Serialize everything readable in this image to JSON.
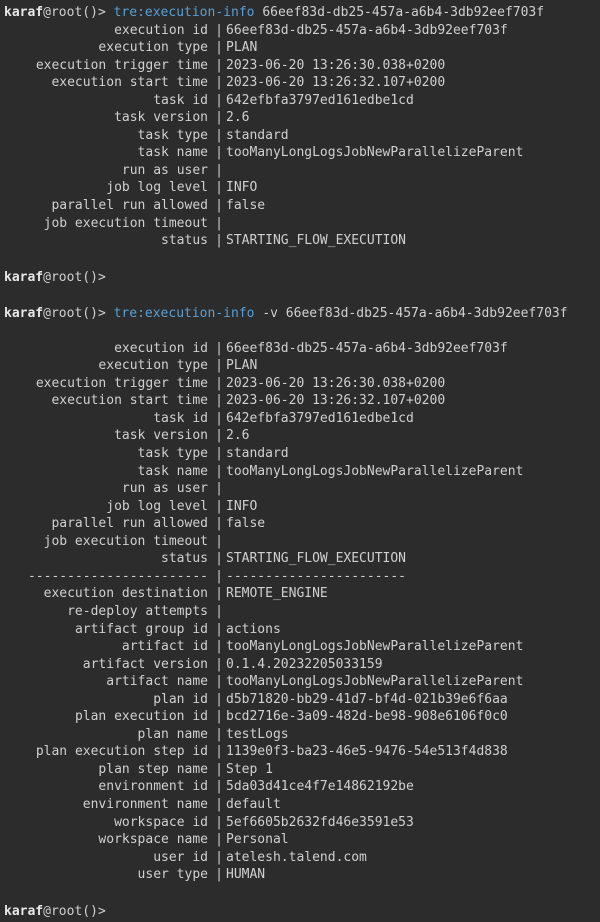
{
  "prompt": {
    "user": "karaf",
    "at": "@",
    "host": "root",
    "paren": "()",
    "gt": ">"
  },
  "cmd1": {
    "command": "tre:execution-info",
    "arg": "66eef83d-db25-457a-a6b4-3db92eef703f"
  },
  "cmd2": {
    "command": "tre:execution-info",
    "flag": "-v",
    "arg": "66eef83d-db25-457a-a6b4-3db92eef703f"
  },
  "sep": "|",
  "dashes_key": "-----------------------",
  "dashes_val": "-----------------------",
  "block1": [
    {
      "k": "execution id",
      "v": "66eef83d-db25-457a-a6b4-3db92eef703f"
    },
    {
      "k": "execution type",
      "v": "PLAN"
    },
    {
      "k": "execution trigger time",
      "v": "2023-06-20 13:26:30.038+0200"
    },
    {
      "k": "execution start time",
      "v": "2023-06-20 13:26:32.107+0200"
    },
    {
      "k": "task id",
      "v": "642efbfa3797ed161edbe1cd"
    },
    {
      "k": "task version",
      "v": "2.6"
    },
    {
      "k": "task type",
      "v": "standard"
    },
    {
      "k": "task name",
      "v": "tooManyLongLogsJobNewParallelizeParent"
    },
    {
      "k": "run as user",
      "v": ""
    },
    {
      "k": "job log level",
      "v": "INFO"
    },
    {
      "k": "parallel run allowed",
      "v": "false"
    },
    {
      "k": "job execution timeout",
      "v": ""
    },
    {
      "k": "status",
      "v": "STARTING_FLOW_EXECUTION"
    }
  ],
  "block2a": [
    {
      "k": "execution id",
      "v": "66eef83d-db25-457a-a6b4-3db92eef703f"
    },
    {
      "k": "execution type",
      "v": "PLAN"
    },
    {
      "k": "execution trigger time",
      "v": "2023-06-20 13:26:30.038+0200"
    },
    {
      "k": "execution start time",
      "v": "2023-06-20 13:26:32.107+0200"
    },
    {
      "k": "task id",
      "v": "642efbfa3797ed161edbe1cd"
    },
    {
      "k": "task version",
      "v": "2.6"
    },
    {
      "k": "task type",
      "v": "standard"
    },
    {
      "k": "task name",
      "v": "tooManyLongLogsJobNewParallelizeParent"
    },
    {
      "k": "run as user",
      "v": ""
    },
    {
      "k": "job log level",
      "v": "INFO"
    },
    {
      "k": "parallel run allowed",
      "v": "false"
    },
    {
      "k": "job execution timeout",
      "v": ""
    },
    {
      "k": "status",
      "v": "STARTING_FLOW_EXECUTION"
    }
  ],
  "block2b": [
    {
      "k": "execution destination",
      "v": "REMOTE_ENGINE"
    },
    {
      "k": "re-deploy attempts",
      "v": ""
    },
    {
      "k": "artifact group id",
      "v": "actions"
    },
    {
      "k": "artifact id",
      "v": "tooManyLongLogsJobNewParallelizeParent"
    },
    {
      "k": "artifact version",
      "v": "0.1.4.20232205033159"
    },
    {
      "k": "artifact name",
      "v": "tooManyLongLogsJobNewParallelizeParent"
    },
    {
      "k": "plan id",
      "v": "d5b71820-bb29-41d7-bf4d-021b39e6f6aa"
    },
    {
      "k": "plan execution id",
      "v": "bcd2716e-3a09-482d-be98-908e6106f0c0"
    },
    {
      "k": "plan name",
      "v": "testLogs"
    },
    {
      "k": "plan execution step id",
      "v": "1139e0f3-ba23-46e5-9476-54e513f4d838"
    },
    {
      "k": "plan step name",
      "v": "Step 1"
    },
    {
      "k": "environment id",
      "v": "5da03d41ce4f7e14862192be"
    },
    {
      "k": "environment name",
      "v": "default"
    },
    {
      "k": "workspace id",
      "v": "5ef6605b2632fd46e3591e53"
    },
    {
      "k": "workspace name",
      "v": "Personal"
    },
    {
      "k": "user id",
      "v": "atelesh.talend.com"
    },
    {
      "k": "user type",
      "v": "HUMAN"
    }
  ]
}
